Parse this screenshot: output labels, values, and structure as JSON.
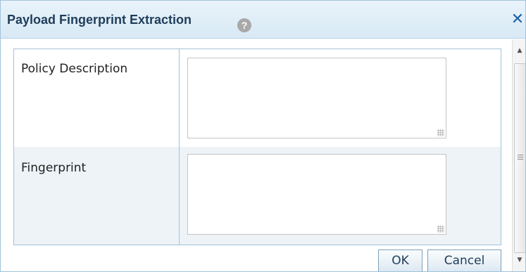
{
  "dialog": {
    "title": "Payload Fingerprint Extraction",
    "help_icon": "help-icon",
    "close_icon": "close-icon"
  },
  "form": {
    "fields": [
      {
        "label": "Policy Description",
        "value": ""
      },
      {
        "label": "Fingerprint",
        "value": ""
      }
    ]
  },
  "buttons": {
    "ok_label": "OK",
    "cancel_label": "Cancel"
  },
  "scrollbar": {
    "up_icon": "scroll-up-arrow",
    "down_icon": "scroll-down-arrow"
  },
  "colors": {
    "title_text": "#1f3d5a",
    "titlebar_bg": "#dbeaf6",
    "border": "#9fc3d9",
    "close_icon": "#1f5fa8",
    "alt_row_bg": "#edf3f7"
  }
}
